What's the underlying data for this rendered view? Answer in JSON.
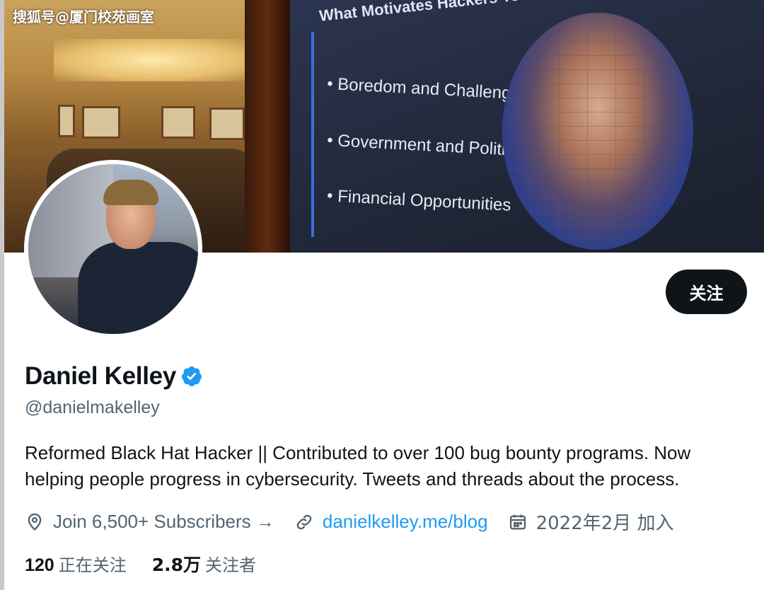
{
  "watermark": "搜狐号@厦门校苑画室",
  "banner": {
    "slide_title": "What Motivates Hackers To Ha",
    "bullets": [
      "Boredom and Challenge",
      "Government and Politics",
      "Financial Opportunities"
    ]
  },
  "profile": {
    "display_name": "Daniel Kelley",
    "handle": "@danielmakelley",
    "bio": "Reformed Black Hat Hacker || Contributed to over 100 bug bounty programs. Now helping people progress in cybersecurity. Tweets and threads about the process.",
    "follow_label": "关注",
    "location": "Join 6,500+ Subscribers →",
    "website": "danielkelley.me/blog",
    "joined": "2022年2月 加入"
  },
  "stats": {
    "following_count": "120",
    "following_label": "正在关注",
    "followers_count": "2.8万",
    "followers_label": "关注者"
  },
  "colors": {
    "accent": "#1d9bf0",
    "text": "#0f1419",
    "secondary": "#536471"
  }
}
